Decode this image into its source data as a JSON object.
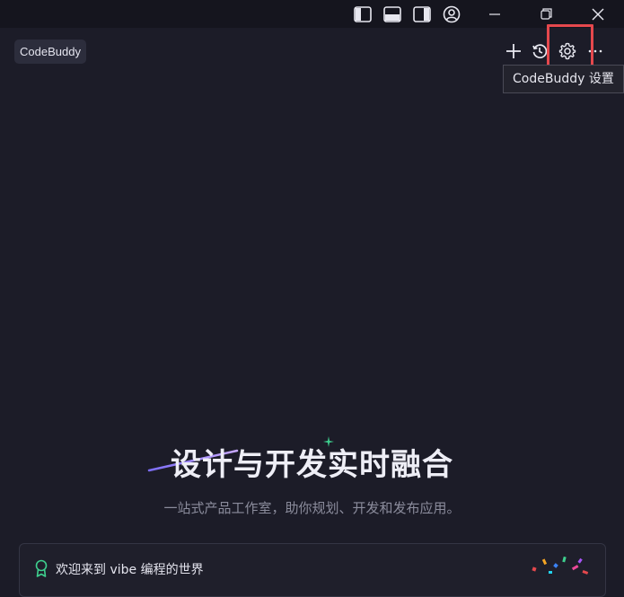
{
  "titlebar": {
    "layout_icons": [
      "sidebar-left-icon",
      "panel-bottom-icon",
      "sidebar-right-icon",
      "account-icon"
    ],
    "window_controls": [
      "minimize-icon",
      "restore-icon",
      "close-icon"
    ]
  },
  "panel": {
    "badge_label": "CodeBuddy",
    "actions": [
      "plus-icon",
      "history-icon",
      "gear-icon",
      "more-icon"
    ],
    "tooltip": "CodeBuddy 设置"
  },
  "hero": {
    "title": "设计与开发实时融合",
    "subtitle": "一站式产品工作室，助你规划、开发和发布应用。"
  },
  "card": {
    "icon": "badge-ribbon-icon",
    "text": "欢迎来到 vibe 编程的世界",
    "decoration": "confetti-icon"
  },
  "colors": {
    "background": "#1c1c28",
    "titlebar": "#15151e",
    "highlight": "#e5484d",
    "accent_green": "#3ecf8e",
    "accent_purple": "#7b6cf6"
  }
}
